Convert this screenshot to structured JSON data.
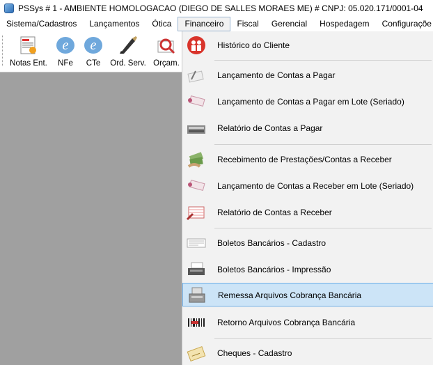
{
  "window": {
    "title": "PSSys # 1 - AMBIENTE HOMOLOGACAO (DIEGO DE SALLES MORAES ME) # CNPJ: 05.020.171/0001-04",
    "app_icon": "app-icon"
  },
  "menubar": {
    "items": [
      {
        "label": "Sistema/Cadastros"
      },
      {
        "label": "Lançamentos"
      },
      {
        "label": "Ótica"
      },
      {
        "label": "Financeiro"
      },
      {
        "label": "Fiscal"
      },
      {
        "label": "Gerencial"
      },
      {
        "label": "Hospedagem"
      },
      {
        "label": "Configuraçõe"
      }
    ],
    "active": "Financeiro"
  },
  "toolbar": {
    "buttons": [
      {
        "label": "Notas Ent.",
        "icon": "invoice-icon"
      },
      {
        "label": "NFe",
        "icon": "nfe-icon"
      },
      {
        "label": "CTe",
        "icon": "cte-icon"
      },
      {
        "label": "Ord. Serv.",
        "icon": "service-order-icon"
      },
      {
        "label": "Orçam.",
        "icon": "quote-icon"
      }
    ]
  },
  "financeiro_menu": {
    "items": [
      {
        "label": "Histórico do Cliente",
        "icon": "client-history-icon"
      },
      {
        "label": "Lançamento de Contas a Pagar",
        "icon": "payable-entry-icon"
      },
      {
        "label": "Lançamento de Contas a Pagar em Lote (Seriado)",
        "icon": "payable-batch-icon"
      },
      {
        "label": "Relatório de Contas a Pagar",
        "icon": "payable-report-icon"
      },
      {
        "label": "Recebimento de Prestações/Contas a Receber",
        "icon": "money-icon"
      },
      {
        "label": "Lançamento de Contas a Receber em Lote (Seriado)",
        "icon": "receivable-batch-icon"
      },
      {
        "label": "Relatório de Contas a Receber",
        "icon": "receivable-report-icon"
      },
      {
        "label": "Boletos Bancários - Cadastro",
        "icon": "boleto-register-icon"
      },
      {
        "label": "Boletos Bancários - Impressão",
        "icon": "boleto-print-icon"
      },
      {
        "label": "Remessa Arquivos Cobrança Bancária",
        "icon": "remittance-icon"
      },
      {
        "label": "Retorno Arquivos Cobrança Bancária",
        "icon": "barcode-return-icon"
      },
      {
        "label": "Cheques - Cadastro",
        "icon": "check-icon"
      }
    ],
    "selected": "Remessa Arquivos Cobrança Bancária"
  },
  "colors": {
    "selection_bg": "#cce4f7",
    "selection_border": "#6eaee6",
    "workspace_bg": "#a0a0a0",
    "menu_bg": "#f2f2f2"
  }
}
